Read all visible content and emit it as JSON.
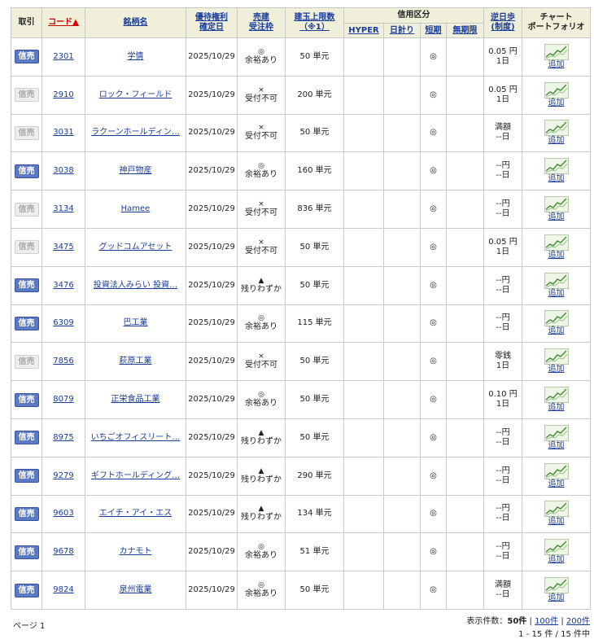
{
  "headers": {
    "trade": "取引",
    "code": "コード▲",
    "name": "銘柄名",
    "benefit_date": [
      "優待権利",
      "確定日"
    ],
    "order": [
      "売建",
      "受注枠"
    ],
    "limit": [
      "建玉上限数",
      "（※1）"
    ],
    "credit": "信用区分",
    "credit_sub": [
      "HYPER",
      "日計り",
      "短期",
      "無期限"
    ],
    "reverse": [
      "逆日歩",
      "(制度)"
    ],
    "chart": [
      "チャート",
      "ポートフォリオ"
    ]
  },
  "rows": [
    {
      "badge": "信売",
      "badge_active": true,
      "code": "2301",
      "name": "学情",
      "date": "2025/10/29",
      "mark": "◎",
      "status": "余裕あり",
      "limit": "50 単元",
      "short": "◎",
      "rev1": "0.05 円",
      "rev2": "1日",
      "add": "追加"
    },
    {
      "badge": "信売",
      "badge_active": false,
      "code": "2910",
      "name": "ロック・フィールド",
      "date": "2025/10/29",
      "mark": "×",
      "status": "受付不可",
      "limit": "200 単元",
      "short": "◎",
      "rev1": "0.05 円",
      "rev2": "1日",
      "add": "追加"
    },
    {
      "badge": "信売",
      "badge_active": false,
      "code": "3031",
      "name": "ラクーンホールディン…",
      "date": "2025/10/29",
      "mark": "×",
      "status": "受付不可",
      "limit": "50 単元",
      "short": "◎",
      "rev1": "満額",
      "rev2": "--日",
      "add": "追加"
    },
    {
      "badge": "信売",
      "badge_active": true,
      "code": "3038",
      "name": "神戸物産",
      "date": "2025/10/29",
      "mark": "◎",
      "status": "余裕あり",
      "limit": "160 単元",
      "short": "◎",
      "rev1": "--円",
      "rev2": "--日",
      "add": "追加"
    },
    {
      "badge": "信売",
      "badge_active": false,
      "code": "3134",
      "name": "Hamee",
      "date": "2025/10/29",
      "mark": "×",
      "status": "受付不可",
      "limit": "836 単元",
      "short": "◎",
      "rev1": "--円",
      "rev2": "--日",
      "add": "追加"
    },
    {
      "badge": "信売",
      "badge_active": false,
      "code": "3475",
      "name": "グッドコムアセット",
      "date": "2025/10/29",
      "mark": "×",
      "status": "受付不可",
      "limit": "50 単元",
      "short": "◎",
      "rev1": "0.05 円",
      "rev2": "1日",
      "add": "追加"
    },
    {
      "badge": "信売",
      "badge_active": true,
      "code": "3476",
      "name": "投資法人みらい 投資…",
      "date": "2025/10/29",
      "mark": "▲",
      "status": "残りわずか",
      "limit": "50 単元",
      "short": "◎",
      "rev1": "--円",
      "rev2": "--日",
      "add": "追加"
    },
    {
      "badge": "信売",
      "badge_active": true,
      "code": "6309",
      "name": "巴工業",
      "date": "2025/10/29",
      "mark": "◎",
      "status": "余裕あり",
      "limit": "115 単元",
      "short": "◎",
      "rev1": "--円",
      "rev2": "--日",
      "add": "追加"
    },
    {
      "badge": "信売",
      "badge_active": false,
      "code": "7856",
      "name": "萩原工業",
      "date": "2025/10/29",
      "mark": "×",
      "status": "受付不可",
      "limit": "50 単元",
      "short": "◎",
      "rev1": "零銭",
      "rev2": "1日",
      "add": "追加"
    },
    {
      "badge": "信売",
      "badge_active": true,
      "code": "8079",
      "name": "正栄食品工業",
      "date": "2025/10/29",
      "mark": "◎",
      "status": "余裕あり",
      "limit": "50 単元",
      "short": "◎",
      "rev1": "0.10 円",
      "rev2": "1日",
      "add": "追加"
    },
    {
      "badge": "信売",
      "badge_active": true,
      "code": "8975",
      "name": "いちごオフィスリート…",
      "date": "2025/10/29",
      "mark": "▲",
      "status": "残りわずか",
      "limit": "50 単元",
      "short": "◎",
      "rev1": "--円",
      "rev2": "--日",
      "add": "追加"
    },
    {
      "badge": "信売",
      "badge_active": true,
      "code": "9279",
      "name": "ギフトホールディング…",
      "date": "2025/10/29",
      "mark": "▲",
      "status": "残りわずか",
      "limit": "290 単元",
      "short": "◎",
      "rev1": "--円",
      "rev2": "--日",
      "add": "追加"
    },
    {
      "badge": "信売",
      "badge_active": true,
      "code": "9603",
      "name": "エイチ・アイ・エス",
      "date": "2025/10/29",
      "mark": "▲",
      "status": "残りわずか",
      "limit": "134 単元",
      "short": "◎",
      "rev1": "--円",
      "rev2": "--日",
      "add": "追加"
    },
    {
      "badge": "信売",
      "badge_active": true,
      "code": "9678",
      "name": "カナモト",
      "date": "2025/10/29",
      "mark": "◎",
      "status": "余裕あり",
      "limit": "51 単元",
      "short": "◎",
      "rev1": "--円",
      "rev2": "--日",
      "add": "追加"
    },
    {
      "badge": "信売",
      "badge_active": true,
      "code": "9824",
      "name": "泉州電業",
      "date": "2025/10/29",
      "mark": "◎",
      "status": "余裕あり",
      "limit": "50 単元",
      "short": "◎",
      "rev1": "満額",
      "rev2": "--日",
      "add": "追加"
    }
  ],
  "footer": {
    "page": "ページ 1",
    "display_label": "表示件数：",
    "current": "50件",
    "sep": "|",
    "opt100": "100件",
    "opt200": "200件",
    "count": "1 - 15 件 / 15 件中"
  },
  "icons": {
    "chart": "mini-line-chart-icon"
  }
}
